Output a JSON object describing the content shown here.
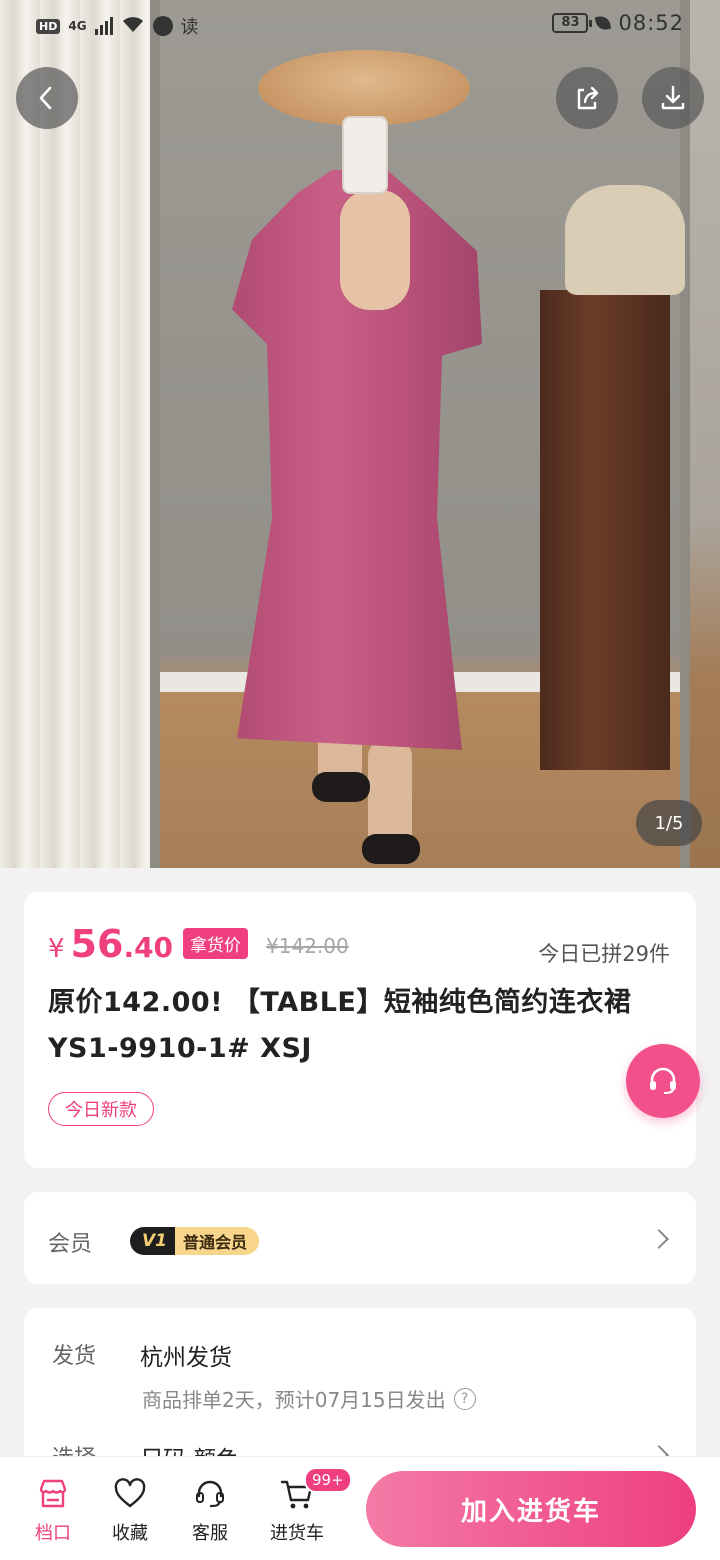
{
  "status_bar": {
    "hd": "HD",
    "network": "4G",
    "read_label": "读",
    "battery": "83",
    "time": "08:52"
  },
  "gallery": {
    "pager": "1/5"
  },
  "product": {
    "currency": "¥",
    "price_int": "56",
    "price_dec": ".40",
    "price_tag": "拿货价",
    "original_price": "¥142.00",
    "sold_today": "今日已拼29件",
    "title": "原价142.00! 【TABLE】短袖纯色简约连衣裙 YS1-9910-1#  XSJ",
    "new_tag": "今日新款"
  },
  "member": {
    "label": "会员",
    "level_badge": "V1",
    "level_name": "普通会员"
  },
  "shipping": {
    "label": "发货",
    "origin": "杭州发货",
    "note": "商品排单2天，预计07月15日发出",
    "select_label": "选择",
    "select_value": "尺码  颜色"
  },
  "bottom_bar": {
    "tabs": [
      {
        "label": "档口",
        "icon": "shop-icon",
        "active": true
      },
      {
        "label": "收藏",
        "icon": "heart-icon",
        "active": false
      },
      {
        "label": "客服",
        "icon": "headset-icon",
        "active": false
      },
      {
        "label": "进货车",
        "icon": "cart-icon",
        "active": false
      }
    ],
    "cart_badge": "99+",
    "cta": "加入进货车"
  },
  "colors": {
    "accent": "#ef3f7e",
    "vip_gold": "#f7d58a"
  }
}
